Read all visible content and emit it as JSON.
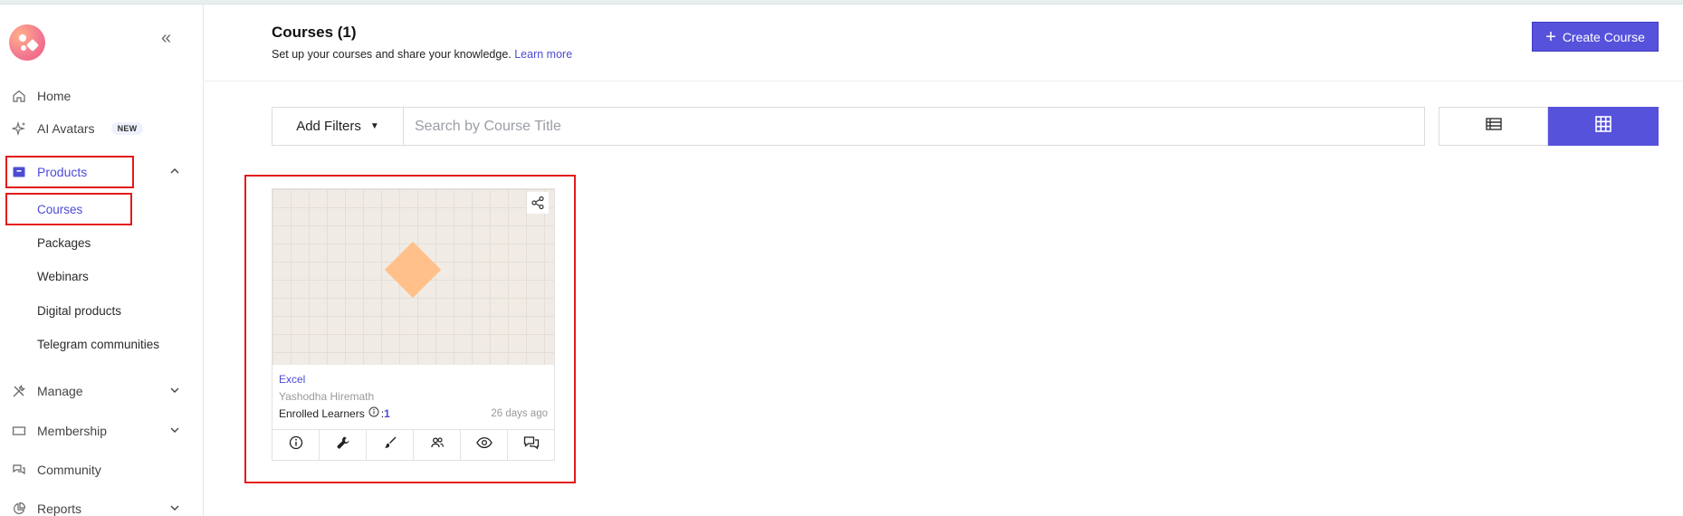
{
  "sidebar": {
    "items": [
      {
        "label": "Home",
        "icon": "home-icon"
      },
      {
        "label": "AI Avatars",
        "icon": "sparkle-icon",
        "badge": "NEW"
      },
      {
        "label": "Products",
        "icon": "box-icon",
        "expanded": true
      },
      {
        "label": "Manage",
        "icon": "tools-icon"
      },
      {
        "label": "Membership",
        "icon": "ticket-icon"
      },
      {
        "label": "Community",
        "icon": "chat-icon"
      },
      {
        "label": "Reports",
        "icon": "pie-chart-icon"
      }
    ],
    "sub_items": [
      "Courses",
      "Packages",
      "Webinars",
      "Digital products",
      "Telegram communities"
    ],
    "active_sub_item": "Courses"
  },
  "header": {
    "title": "Courses (1)",
    "subtitle": "Set up your courses and share your knowledge.",
    "learn_more": "Learn more",
    "create_button": "Create Course"
  },
  "filters": {
    "add_filters_label": "Add Filters",
    "search_placeholder": "Search by Course Title",
    "view_mode": "grid"
  },
  "courses": [
    {
      "name": "Excel",
      "author": "Yashodha Hiremath",
      "enrolled_label": "Enrolled Learners",
      "enrolled_separator": ":",
      "enrolled_count": "1",
      "updated": "26 days ago"
    }
  ],
  "colors": {
    "accent": "#5652db",
    "highlight": "#e31b1b",
    "thumbnail_shape": "#ffc08a"
  }
}
